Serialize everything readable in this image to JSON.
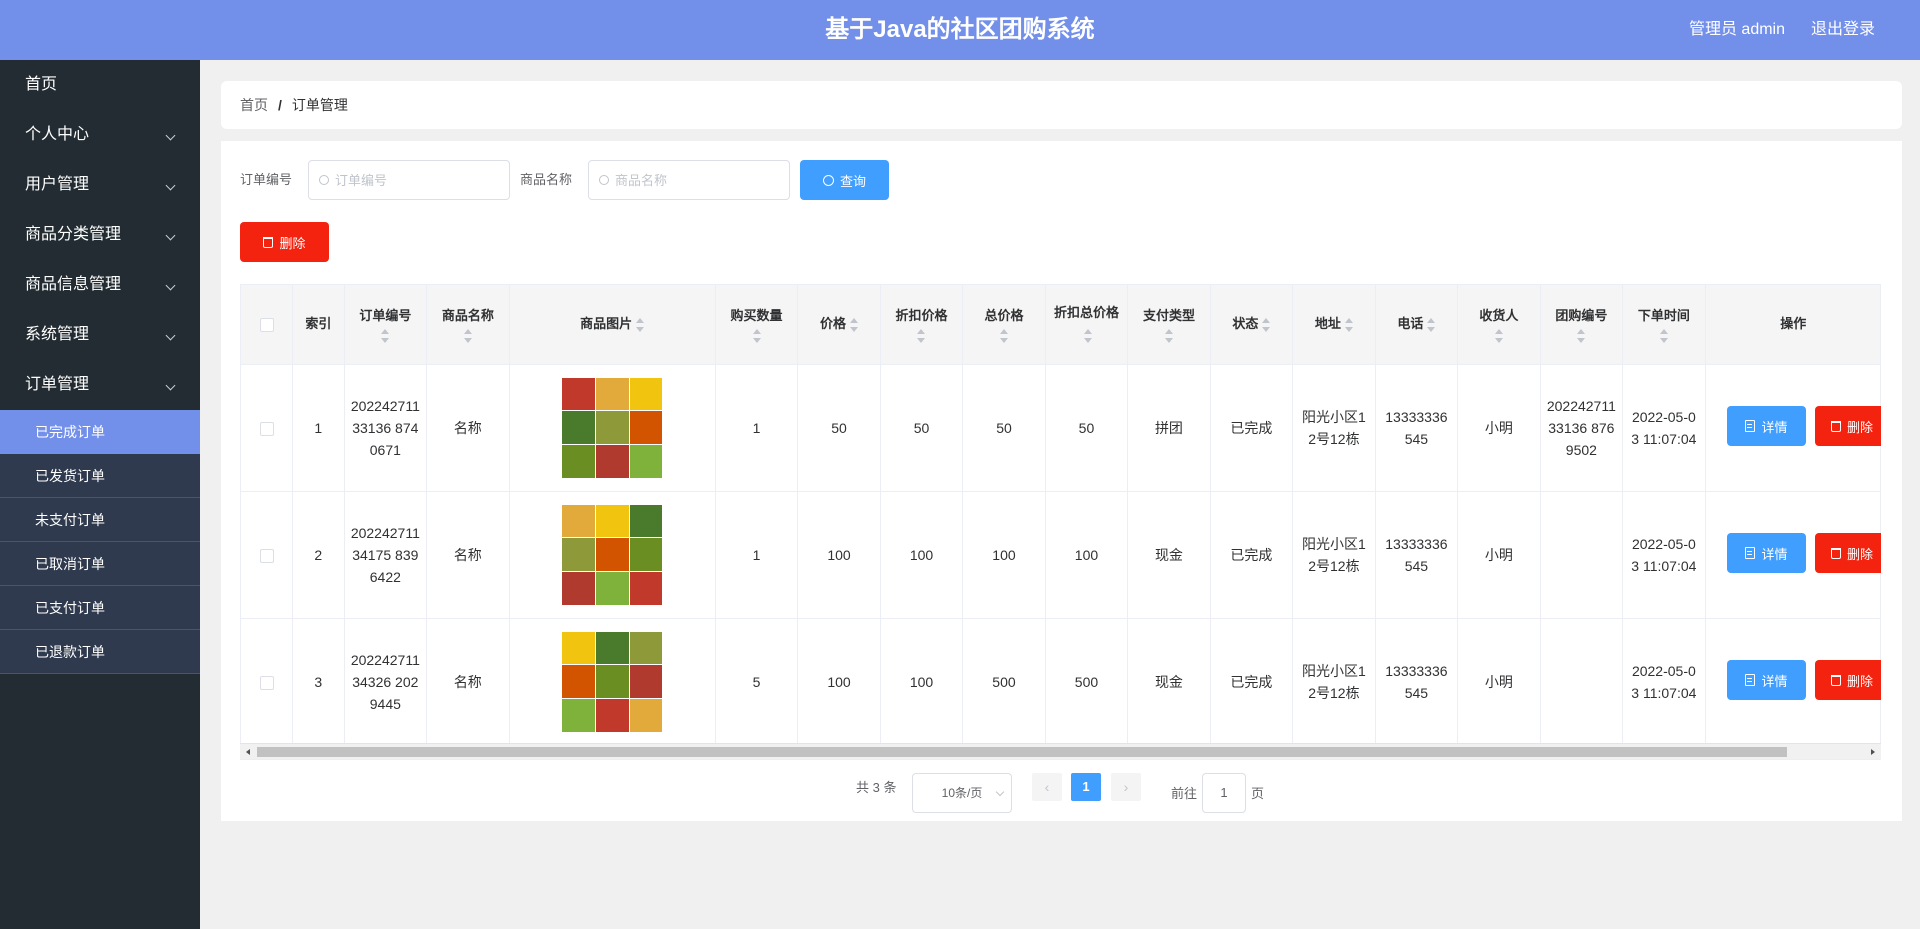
{
  "header": {
    "title": "基于Java的社区团购系统",
    "user": "管理员 admin",
    "logout": "退出登录"
  },
  "sidebar": {
    "items": [
      {
        "label": "首页"
      },
      {
        "label": "个人中心"
      },
      {
        "label": "用户管理"
      },
      {
        "label": "商品分类管理"
      },
      {
        "label": "商品信息管理"
      },
      {
        "label": "系统管理"
      },
      {
        "label": "订单管理"
      }
    ],
    "sub_items": [
      {
        "label": "已完成订单"
      },
      {
        "label": "已发货订单"
      },
      {
        "label": "未支付订单"
      },
      {
        "label": "已取消订单"
      },
      {
        "label": "已支付订单"
      },
      {
        "label": "已退款订单"
      }
    ]
  },
  "breadcrumb": {
    "home": "首页",
    "sep": "/",
    "current": "订单管理"
  },
  "search": {
    "order_no_label": "订单编号",
    "order_no_placeholder": "订单编号",
    "product_label": "商品名称",
    "product_placeholder": "商品名称",
    "query_button": "查询"
  },
  "toolbar": {
    "delete_button": "删除"
  },
  "table": {
    "columns": [
      "索引",
      "订单编号",
      "商品名称",
      "商品图片",
      "购买数量",
      "价格",
      "折扣价格",
      "总价格",
      "折扣总价格",
      "支付类型",
      "状态",
      "地址",
      "电话",
      "收货人",
      "团购编号",
      "下单时间",
      "操作"
    ],
    "rows": [
      {
        "index": "1",
        "order_no": "20224271133136 8740671",
        "name": "名称",
        "qty": "1",
        "price": "50",
        "discount_price": "50",
        "total": "50",
        "discount_total": "50",
        "pay_type": "拼团",
        "status": "已完成",
        "address": "阳光小区12号12栋",
        "phone": "13333336545",
        "receiver": "小明",
        "group_no": "20224271133136 8769502",
        "time": "2022-05-03 11:07:04"
      },
      {
        "index": "2",
        "order_no": "20224271134175 8396422",
        "name": "名称",
        "qty": "1",
        "price": "100",
        "discount_price": "100",
        "total": "100",
        "discount_total": "100",
        "pay_type": "现金",
        "status": "已完成",
        "address": "阳光小区12号12栋",
        "phone": "13333336545",
        "receiver": "小明",
        "group_no": "",
        "time": "2022-05-03 11:07:04"
      },
      {
        "index": "3",
        "order_no": "20224271134326 2029445",
        "name": "名称",
        "qty": "5",
        "price": "100",
        "discount_price": "100",
        "total": "500",
        "discount_total": "500",
        "pay_type": "现金",
        "status": "已完成",
        "address": "阳光小区12号12栋",
        "phone": "13333336545",
        "receiver": "小明",
        "group_no": "",
        "time": "2022-05-03 11:07:04"
      }
    ],
    "detail_button": "详情",
    "delete_button": "删除"
  },
  "pagination": {
    "total": "共 3 条",
    "page_size": "10条/页",
    "current_page": "1",
    "goto_label": "前往",
    "goto_value": "1",
    "page_label": "页"
  },
  "colors": {
    "header": "#728fea",
    "sidebar": "#222c32",
    "primary": "#409eff",
    "danger": "#f4230f"
  }
}
